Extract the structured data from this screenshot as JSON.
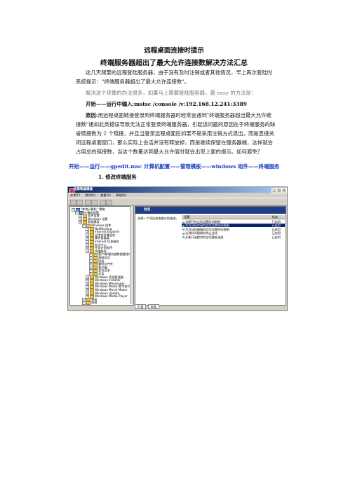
{
  "doc": {
    "title": "远程桌面连接时提示",
    "subtitle": "终端服务器超出了最大允许连接数解决方法汇总",
    "p1": "这几天频繁的远程登陆服务器，由于没有及时注销或者其他情况，早上再次登陆时系统提示：\"终端服务器超出了最大允许连接数\"。",
    "p2": "解决这个现像的办法很多，如果马上需要登陆服务器，最 easy 的方法是：",
    "p3": "开始——运行中输入:mstsc /console /v:192.168.12.241:3389",
    "p4_label": "原因:",
    "p4": "用远程桌面链接登录到终端服务器时经常会遇到\"终端服务器超出最大允许链接数\"诸如此类错误导致无法正常登录终端服务器，引起该问题的原因在于终端服务的缺省链接数为 2 个链接，并且当登录远程桌面后如果不是采用注销方式退出，而是直接关闭远程桌面窗口，那么实际上会话并没有释放掉，而是继续保留在服务器端，这样就会占用总的链接数，当这个数量达到最大允许值时就会出现上面的提示。如何避免？",
    "p5": "开始——运行——gpedit.msc 计算机配置——管理模板——windows 组件——终端服务",
    "step": "1.   修改终端服务"
  },
  "screenshot": {
    "window_title": "组策略编辑器",
    "menu": [
      "文件(F)",
      "操作(A)",
      "查看(V)",
      "帮助(H)"
    ],
    "tree": [
      {
        "label": "\"本地计算机\" 策略",
        "level": 0,
        "icon": "computer"
      },
      {
        "label": "计算机配置",
        "level": 1,
        "icon": "computer"
      },
      {
        "label": "软件设置",
        "level": 2,
        "icon": "folder"
      },
      {
        "label": "Windows 设置",
        "level": 2,
        "icon": "folder"
      },
      {
        "label": "管理模板",
        "level": 2,
        "icon": "folder"
      },
      {
        "label": "Windows 组件",
        "level": 3,
        "icon": "folder"
      },
      {
        "label": "NetMeeting",
        "level": 4,
        "icon": "folder"
      },
      {
        "label": "Internet Explorer",
        "level": 4,
        "icon": "folder"
      },
      {
        "label": "应用程序兼容性",
        "level": 4,
        "icon": "folder"
      },
      {
        "label": "事件查看器",
        "level": 4,
        "icon": "folder"
      },
      {
        "label": "Internet 信息服务",
        "level": 4,
        "icon": "folder"
      },
      {
        "label": "安全中心",
        "level": 4,
        "icon": "folder"
      },
      {
        "label": "任务计划程序",
        "level": 4,
        "icon": "folder"
      },
      {
        "label": "终端服务",
        "level": 4,
        "icon": "folder"
      },
      {
        "label": "客户端/服务器数据重定向",
        "level": 5,
        "icon": "folder"
      },
      {
        "label": "限制会话",
        "level": 5,
        "icon": "folder"
      },
      {
        "label": "授权",
        "level": 5,
        "icon": "folder"
      },
      {
        "label": "临时文件夹",
        "level": 5,
        "icon": "folder"
      },
      {
        "label": "客户端",
        "level": 5,
        "icon": "folder"
      },
      {
        "label": "会话目录",
        "level": 5,
        "icon": "folder"
      },
      {
        "label": "会话",
        "level": 5,
        "icon": "folder"
      },
      {
        "label": "Windows 资源管理器",
        "level": 4,
        "icon": "folder"
      },
      {
        "label": "Windows Installer",
        "level": 4,
        "icon": "folder"
      },
      {
        "label": "Windows Messenger",
        "level": 4,
        "icon": "folder"
      },
      {
        "label": "Windows Media 数字权利管理",
        "level": 4,
        "icon": "folder"
      },
      {
        "label": "Windows Movie Maker",
        "level": 4,
        "icon": "folder"
      },
      {
        "label": "Windows Update",
        "level": 4,
        "icon": "folder"
      },
      {
        "label": "Windows Media Player",
        "level": 4,
        "icon": "folder"
      },
      {
        "label": "系统",
        "level": 3,
        "icon": "folder"
      },
      {
        "label": "网络",
        "level": 3,
        "icon": "folder"
      }
    ],
    "right_header": "会话",
    "right_prompt": "选择一个项目来查看它的描述。",
    "col_setting": "设置",
    "col_state": "状态",
    "settings": [
      {
        "label": "为断开的会话设置时间限制",
        "state": "已启用",
        "selected": false
      },
      {
        "label": "为活动但空闲的会话设置时间限制",
        "state": "已启用",
        "selected": true
      },
      {
        "label": "为活动终端服务会话设置时间限制",
        "state": "已启用",
        "selected": false
      },
      {
        "label": "达到时间限制时终止会话",
        "state": "已启用",
        "selected": false
      },
      {
        "label": "从断开或超时的会话重新连接",
        "state": "已启用",
        "selected": false
      }
    ],
    "tabs": [
      "扩展",
      "标准"
    ]
  }
}
